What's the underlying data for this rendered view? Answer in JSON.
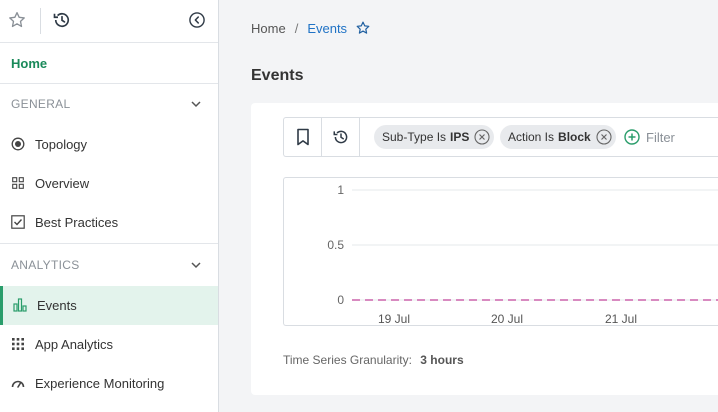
{
  "sidebar": {
    "home_label": "Home",
    "sections": [
      {
        "title": "GENERAL",
        "items": [
          "Topology",
          "Overview",
          "Best Practices"
        ]
      },
      {
        "title": "ANALYTICS",
        "items": [
          "Events",
          "App Analytics",
          "Experience Monitoring"
        ]
      }
    ],
    "active_item": "Events"
  },
  "breadcrumb": {
    "home": "Home",
    "separator": "/",
    "current": "Events"
  },
  "page_title": "Events",
  "filters": [
    {
      "key": "Sub-Type Is",
      "value": "IPS"
    },
    {
      "key": "Action Is",
      "value": "Block"
    }
  ],
  "filter_placeholder": "Filter",
  "chart_data": {
    "type": "line",
    "y_ticks": [
      "1",
      "0.5",
      "0"
    ],
    "x_ticks": [
      "19 Jul",
      "20 Jul",
      "21 Jul"
    ],
    "ylim": [
      0,
      1
    ],
    "series": [
      {
        "values": [
          0,
          0,
          0,
          0
        ]
      }
    ],
    "series_color": "#c0449a",
    "grid": true
  },
  "granularity": {
    "label": "Time Series Granularity:",
    "value": "3 hours"
  },
  "colors": {
    "accent_green": "#1a8a5a",
    "link_blue": "#1f72c5",
    "active_bg": "#e3f3ec"
  }
}
